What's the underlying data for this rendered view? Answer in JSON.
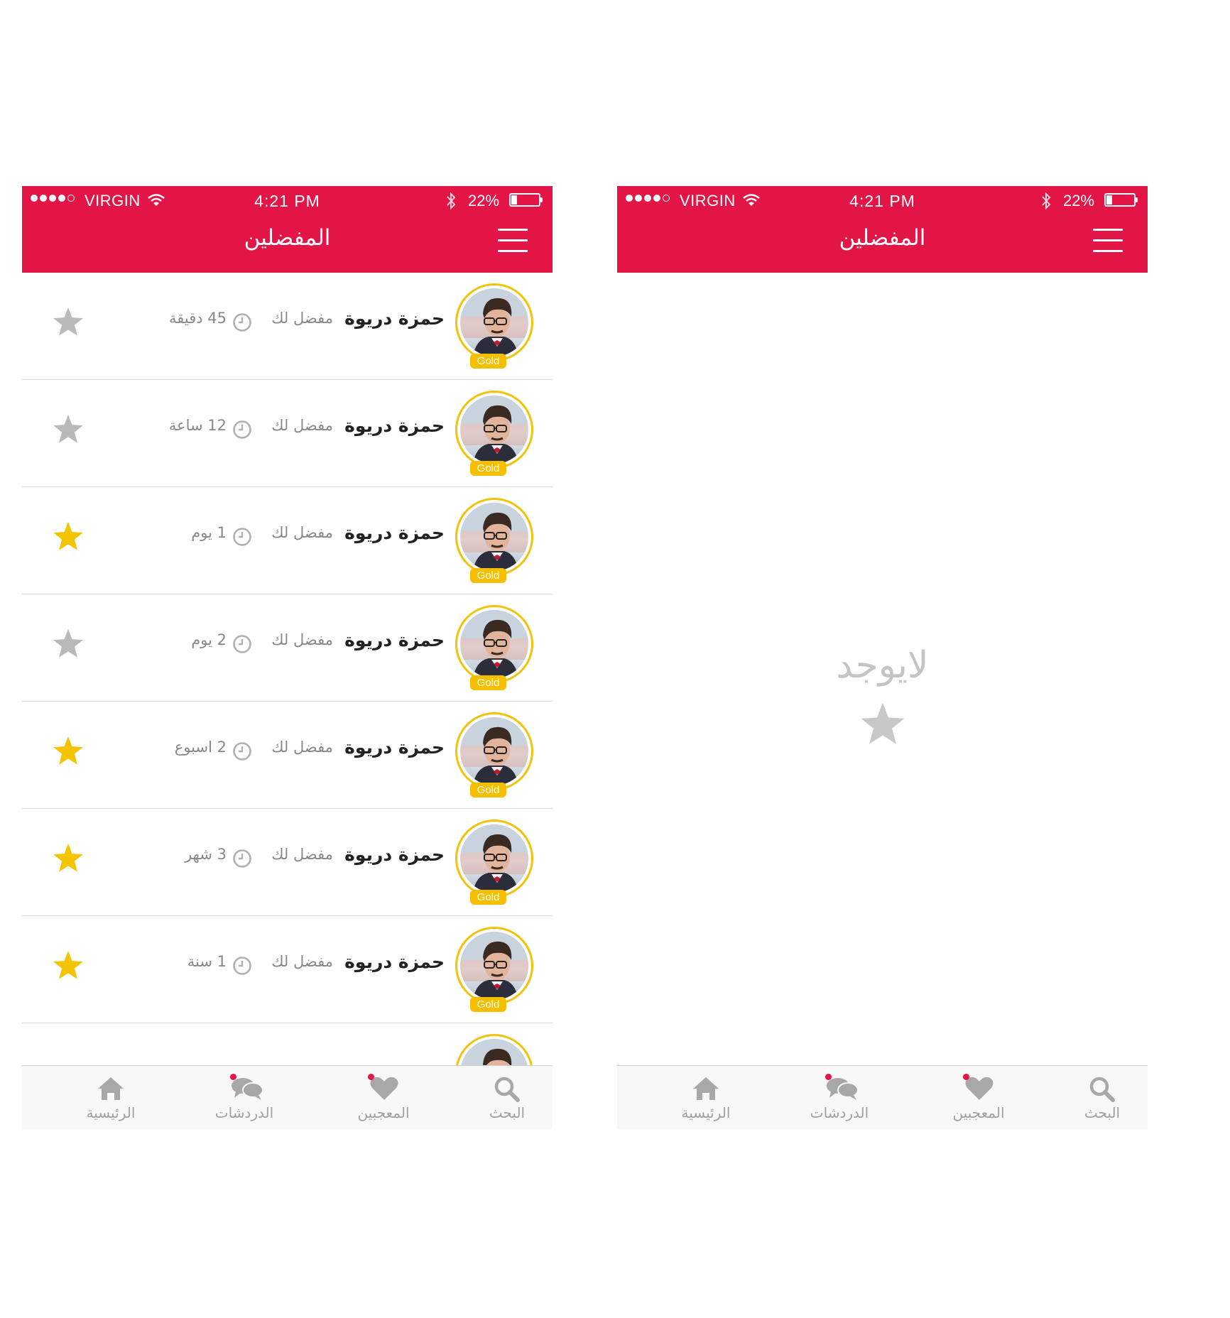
{
  "status_bar": {
    "carrier": "VIRGIN",
    "time": "4:21 PM",
    "battery_percent": "22%",
    "battery_level": 0.22
  },
  "nav": {
    "title": "المفضلين"
  },
  "rows": [
    {
      "name": "حمزة دريوة",
      "sub": "مفضل لك",
      "ago": "45 دقيقة",
      "badge": "Gold",
      "starred": false
    },
    {
      "name": "حمزة دريوة",
      "sub": "مفضل لك",
      "ago": "12 ساعة",
      "badge": "Gold",
      "starred": false
    },
    {
      "name": "حمزة دريوة",
      "sub": "مفضل لك",
      "ago": "1 يوم",
      "badge": "Gold",
      "starred": true
    },
    {
      "name": "حمزة دريوة",
      "sub": "مفضل لك",
      "ago": "2 يوم",
      "badge": "Gold",
      "starred": false
    },
    {
      "name": "حمزة دريوة",
      "sub": "مفضل لك",
      "ago": "2 اسبوع",
      "badge": "Gold",
      "starred": true
    },
    {
      "name": "حمزة دريوة",
      "sub": "مفضل لك",
      "ago": "3 شهر",
      "badge": "Gold",
      "starred": true
    },
    {
      "name": "حمزة دريوة",
      "sub": "مفضل لك",
      "ago": "1 سنة",
      "badge": "Gold",
      "starred": true
    }
  ],
  "empty_state": {
    "text": "لايوجد"
  },
  "tabs": [
    {
      "label": "الرئيسية",
      "icon": "home-icon",
      "notification": false
    },
    {
      "label": "الدردشات",
      "icon": "chat-icon",
      "notification": true
    },
    {
      "label": "المعجبين",
      "icon": "heart-icon",
      "notification": true
    },
    {
      "label": "البحث",
      "icon": "search-icon",
      "notification": false
    }
  ],
  "colors": {
    "brand": "#e31546",
    "gold": "#f5bf00",
    "star_active": "#f5c400",
    "star_inactive": "#b9b9b9",
    "tab_inactive": "#a0a0a0"
  }
}
